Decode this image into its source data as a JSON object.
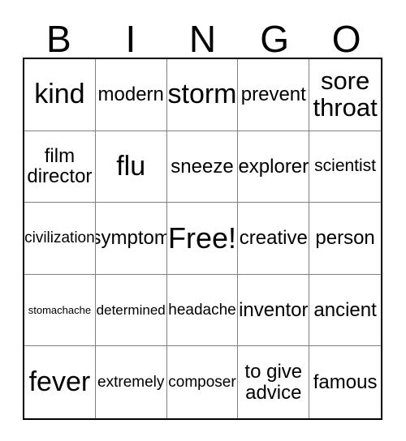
{
  "card": {
    "title": "BINGO",
    "headers": [
      "B",
      "I",
      "N",
      "G",
      "O"
    ],
    "free_space_label": "Free!",
    "colors": {
      "outer_border": "#000000",
      "inner_grid_line": "#808080",
      "cell_background": "#ffffff",
      "text": "#000000"
    },
    "rows": [
      [
        {
          "text": "kind",
          "size": "sz-lg"
        },
        {
          "text": "modern",
          "size": "sz-md"
        },
        {
          "text": "storm",
          "size": "sz-lg"
        },
        {
          "text": "prevent",
          "size": "sz-md"
        },
        {
          "text": "sore throat",
          "size": "sz-ml"
        }
      ],
      [
        {
          "text": "film director",
          "size": "sz-md"
        },
        {
          "text": "flu",
          "size": "sz-lg"
        },
        {
          "text": "sneeze",
          "size": "sz-md"
        },
        {
          "text": "explorer",
          "size": "sz-md"
        },
        {
          "text": "scientist",
          "size": "sz-sm"
        }
      ],
      [
        {
          "text": "civilization",
          "size": "sz-xs"
        },
        {
          "text": "symptom",
          "size": "sz-md"
        },
        {
          "text": "Free!",
          "size": "sz-xl"
        },
        {
          "text": "creative",
          "size": "sz-md"
        },
        {
          "text": "person",
          "size": "sz-md"
        }
      ],
      [
        {
          "text": "stomachache",
          "size": "sz-tiny"
        },
        {
          "text": "determined",
          "size": "sz-xxs"
        },
        {
          "text": "headache",
          "size": "sz-xs"
        },
        {
          "text": "inventor",
          "size": "sz-md"
        },
        {
          "text": "ancient",
          "size": "sz-md"
        }
      ],
      [
        {
          "text": "fever",
          "size": "sz-lg"
        },
        {
          "text": "extremely",
          "size": "sz-xs"
        },
        {
          "text": "composer",
          "size": "sz-xs"
        },
        {
          "text": "to give advice",
          "size": "sz-md"
        },
        {
          "text": "famous",
          "size": "sz-md"
        }
      ]
    ]
  }
}
